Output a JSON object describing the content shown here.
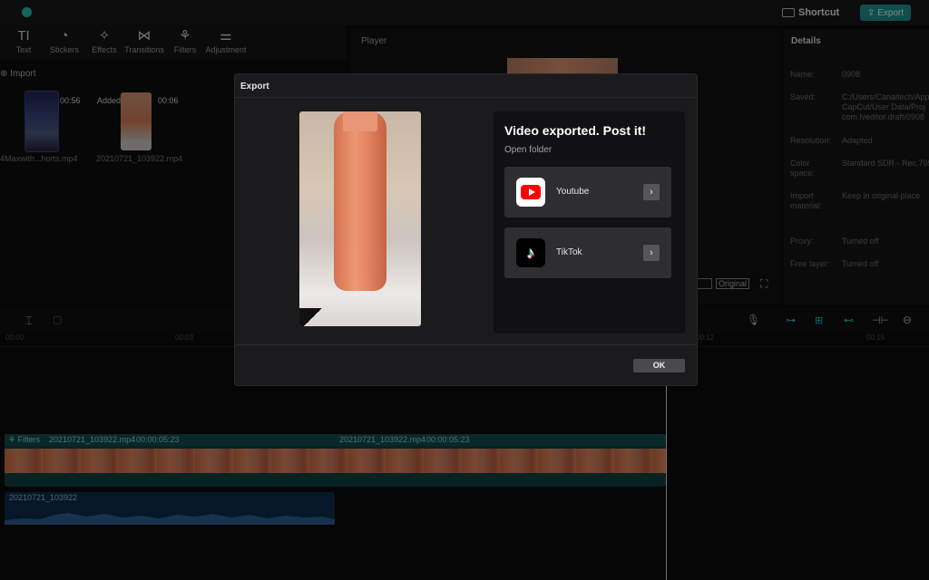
{
  "topbar": {
    "app_title": "",
    "project_name": "",
    "shortcut_label": "Shortcut",
    "export_label": "Export"
  },
  "toolbar": {
    "items": [
      {
        "label": "Text",
        "icon": "TI"
      },
      {
        "label": "Stickers",
        "icon": "◔"
      },
      {
        "label": "Effects",
        "icon": "✧"
      },
      {
        "label": "Transitions",
        "icon": "⋈"
      },
      {
        "label": "Filters",
        "icon": "⚘"
      },
      {
        "label": "Adjustment",
        "icon": "⚌"
      }
    ]
  },
  "media": {
    "import_label": "Import",
    "clips": [
      {
        "duration": "00:56",
        "name": "4Maxwith...horts.mp4"
      },
      {
        "duration": "00:06",
        "name": "20210721_103922.mp4",
        "tag": "Added"
      }
    ]
  },
  "player": {
    "label": "Player",
    "original_label": "Original"
  },
  "details": {
    "title": "Details",
    "rows": [
      {
        "key": "Name:",
        "value": "0908"
      },
      {
        "key": "Saved:",
        "value": "C:/Users/Canaltech/App\nCapCut/User Data/Proj\ncom.lveditor.draft/0908"
      },
      {
        "key": "Resolution:",
        "value": "Adapted"
      },
      {
        "key": "Color\nspace:",
        "value": "Standard SDR - Rec.709"
      },
      {
        "key": "Import\nmaterial:",
        "value": "Keep in original place"
      },
      {
        "key": "Proxy:",
        "value": "Turned off"
      },
      {
        "key": "Free layer:",
        "value": "Turned off"
      }
    ]
  },
  "timeline": {
    "ticks": [
      "00:00",
      "00:03",
      "00:12",
      "00:15"
    ],
    "video_track": {
      "filter_label": "Filters",
      "clips": [
        {
          "name": "20210721_103922.mp4",
          "duration": "00:00:05:23"
        },
        {
          "name": "20210721_103922.mp4",
          "duration": "00:00:05:23"
        }
      ]
    },
    "audio_track": {
      "name": "20210721_103922"
    }
  },
  "dialog": {
    "title": "Export",
    "post_title": "Video exported. Post it!",
    "open_folder": "Open folder",
    "share_targets": [
      {
        "label": "Youtube",
        "icon": "youtube-icon"
      },
      {
        "label": "TikTok",
        "icon": "tiktok-icon"
      }
    ],
    "ok_label": "OK"
  },
  "colors": {
    "accent": "#1a8f8a",
    "youtube_red": "#ff0000",
    "dialog_bg": "#1b1b1d"
  }
}
